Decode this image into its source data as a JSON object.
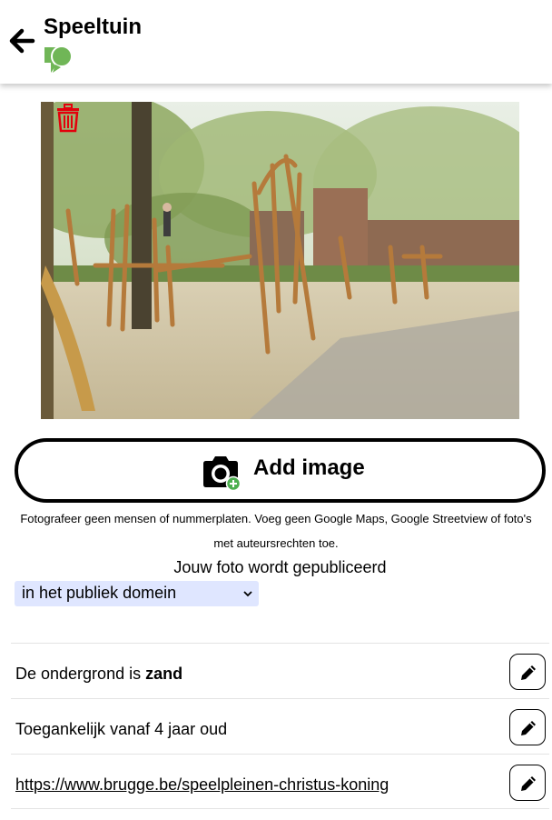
{
  "header": {
    "title": "Speeltuin",
    "back_icon": "arrow-left-icon",
    "theme_icon": "map-marker-icon",
    "theme_color": "#70b657"
  },
  "photo": {
    "delete_icon": "trash-icon",
    "delete_color": "#e3000b"
  },
  "add_image": {
    "label": "Add image",
    "icon": "camera-plus-icon",
    "plus_color": "#4caf50"
  },
  "hint": {
    "line1": "Fotografeer geen mensen of nummerplaten. Voeg geen Google Maps, Google Streetview of foto's",
    "line2": "met auteursrechten toe."
  },
  "license": {
    "label": "Jouw foto wordt gepubliceerd",
    "selected": "in het publiek domein",
    "select_bg": "#dfe6ff"
  },
  "rows": [
    {
      "prefix": "De ondergrond is ",
      "value": "zand",
      "edit_icon": "pencil-icon"
    },
    {
      "text": "Toegankelijk vanaf 4 jaar oud",
      "edit_icon": "pencil-icon"
    },
    {
      "link": "https://www.brugge.be/speelpleinen-christus-koning",
      "edit_icon": "pencil-icon"
    }
  ]
}
